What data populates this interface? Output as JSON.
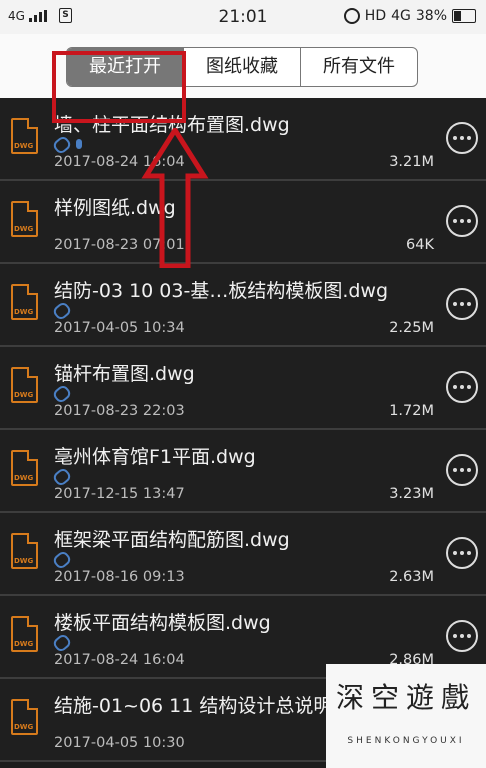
{
  "status_bar": {
    "network": "4G",
    "time": "21:01",
    "hd": "HD",
    "network2": "4G",
    "battery": "38%"
  },
  "tabs": [
    {
      "label": "最近打开",
      "active": true
    },
    {
      "label": "图纸收藏",
      "active": false
    },
    {
      "label": "所有文件",
      "active": false
    }
  ],
  "files": [
    {
      "name": "墙、柱平面结构布置图.dwg",
      "date": "2017-08-24 16:04",
      "size": "3.21M",
      "attach": true,
      "voice": true
    },
    {
      "name": "样例图纸.dwg",
      "date": "2017-08-23 07:01",
      "size": "64K",
      "attach": false,
      "voice": false
    },
    {
      "name": "结防-03 10 03-基…板结构模板图.dwg",
      "date": "2017-04-05 10:34",
      "size": "2.25M",
      "attach": true,
      "voice": false
    },
    {
      "name": "锚杆布置图.dwg",
      "date": "2017-08-23 22:03",
      "size": "1.72M",
      "attach": true,
      "voice": false
    },
    {
      "name": "亳州体育馆F1平面.dwg",
      "date": "2017-12-15 13:47",
      "size": "3.23M",
      "attach": true,
      "voice": false
    },
    {
      "name": "框架梁平面结构配筋图.dwg",
      "date": "2017-08-16 09:13",
      "size": "2.63M",
      "attach": true,
      "voice": false
    },
    {
      "name": "楼板平面结构模板图.dwg",
      "date": "2017-08-24 16:04",
      "size": "2.86M",
      "attach": true,
      "voice": false
    },
    {
      "name": "结施-01~06 11 结构设计总说明",
      "date": "2017-04-05 10:30",
      "size": "",
      "attach": false,
      "voice": false
    }
  ],
  "file_icon_label": "DWG",
  "watermark": {
    "chars": [
      "深",
      "空",
      "遊",
      "戲"
    ],
    "sub": "SHENKONGYOUXI"
  },
  "colors": {
    "highlight": "#c8151d",
    "file_icon": "#d77b1c",
    "attach_icon": "#4a7fc4"
  }
}
